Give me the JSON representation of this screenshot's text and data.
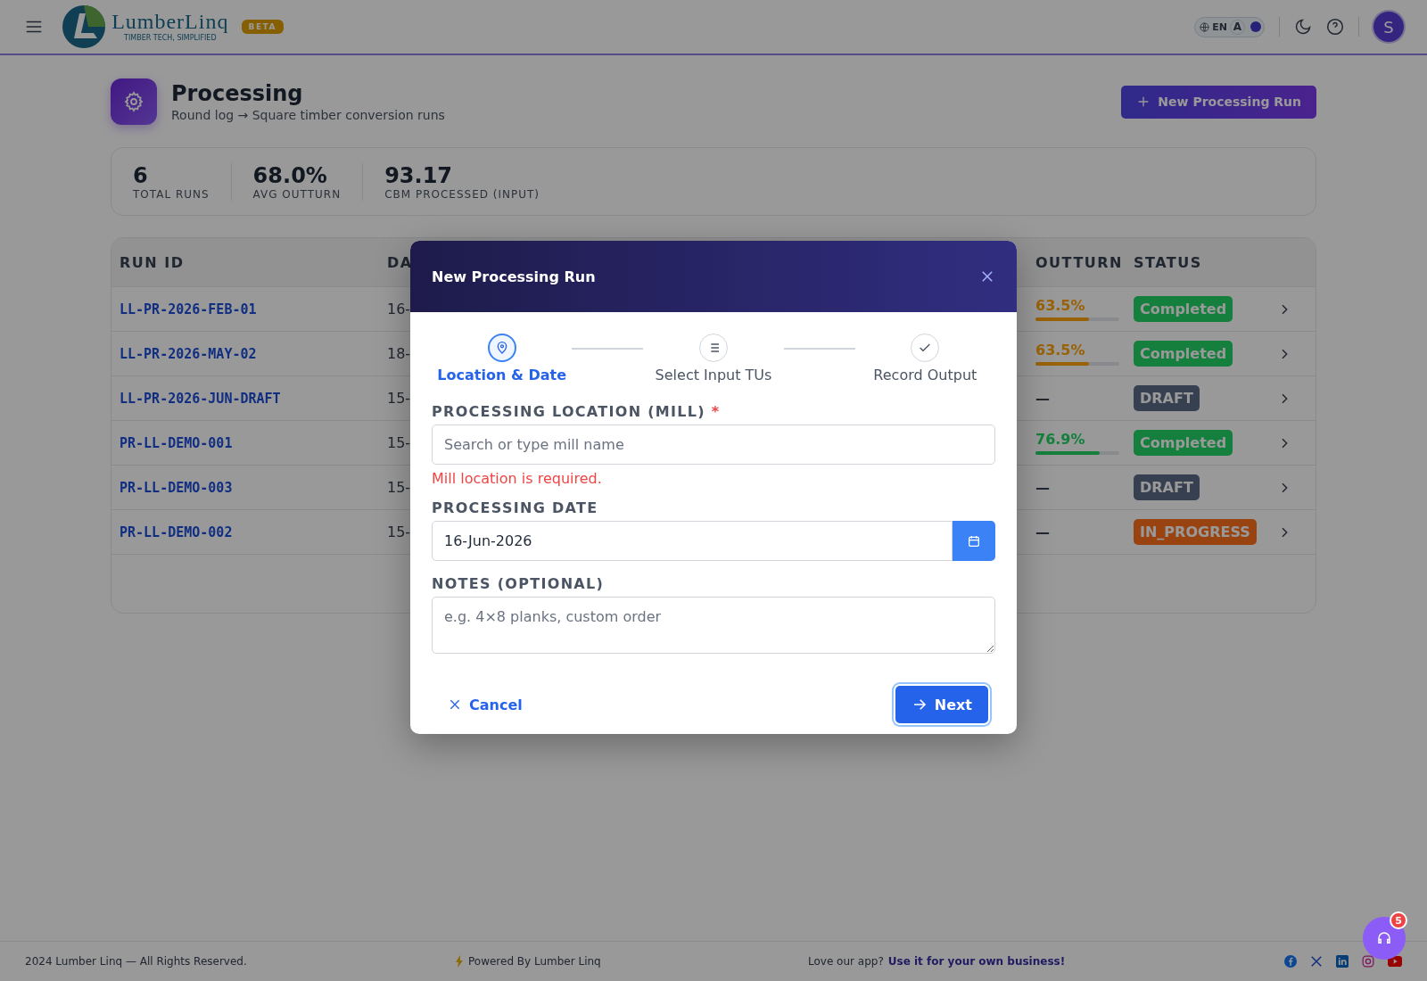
{
  "header": {
    "logo_name": "LumberLinq",
    "logo_tagline": "TIMBER TECH, SIMPLIFIED",
    "badge": "BETA",
    "language": "EN",
    "font_toggle": "A",
    "avatar": "S"
  },
  "page": {
    "title": "Processing",
    "subtitle": "Round log → Square timber conversion runs",
    "new_button": "New Processing Run"
  },
  "stats": [
    {
      "value": "6",
      "label": "TOTAL RUNS"
    },
    {
      "value": "68.0%",
      "label": "AVG OUTTURN"
    },
    {
      "value": "93.17",
      "label": "CBM PROCESSED (INPUT)"
    }
  ],
  "table": {
    "columns": [
      "RUN ID",
      "DA",
      "OUTTURN",
      "STATUS"
    ],
    "rows": [
      {
        "run_id": "LL-PR-2026-FEB-01",
        "date": "16-",
        "outturn": "63.5%",
        "level": 0.635,
        "color": "#a16207",
        "status": {
          "label": "Completed",
          "color": "#15803d"
        }
      },
      {
        "run_id": "LL-PR-2026-MAY-02",
        "date": "18-",
        "outturn": "63.5%",
        "level": 0.635,
        "color": "#a16207",
        "status": {
          "label": "Completed",
          "color": "#15803d"
        }
      },
      {
        "run_id": "LL-PR-2026-JUN-DRAFT",
        "date": "15-",
        "outturn": "—",
        "status": {
          "label": "DRAFT",
          "color": "#374151"
        }
      },
      {
        "run_id": "PR-LL-DEMO-001",
        "date": "15-",
        "outturn": "76.9%",
        "level": 0.769,
        "color": "#15803d",
        "status": {
          "label": "Completed",
          "color": "#15803d"
        }
      },
      {
        "run_id": "PR-LL-DEMO-003",
        "date": "15-",
        "outturn": "—",
        "status": {
          "label": "DRAFT",
          "color": "#374151"
        }
      },
      {
        "run_id": "PR-LL-DEMO-002",
        "date": "15-",
        "outturn": "—",
        "status": {
          "label": "IN_PROGRESS",
          "color": "#9a4410"
        }
      }
    ]
  },
  "modal": {
    "title": "New Processing Run",
    "steps": [
      {
        "label": "Location & Date",
        "kind": "pin",
        "selected": true
      },
      {
        "label": "Select Input TUs",
        "kind": "list",
        "selected": false
      },
      {
        "label": "Record Output",
        "kind": "check",
        "selected": false
      }
    ],
    "location": {
      "label": "PROCESSING LOCATION (MILL)",
      "required": "*",
      "placeholder": "Search or type mill name",
      "error": "Mill location is required."
    },
    "date": {
      "label": "PROCESSING DATE",
      "value": "16-Jun-2026"
    },
    "notes": {
      "label": "NOTES (OPTIONAL)",
      "placeholder": "e.g. 4×8 planks, custom order"
    },
    "cancel": "Cancel",
    "next": "Next"
  },
  "footer": {
    "copyright": "2024 Lumber Linq — All Rights Reserved.",
    "powered": "Powered By Lumber Linq",
    "love": "Love our app?",
    "link": "Use it for your own business!"
  },
  "support": {
    "badge": "5"
  }
}
